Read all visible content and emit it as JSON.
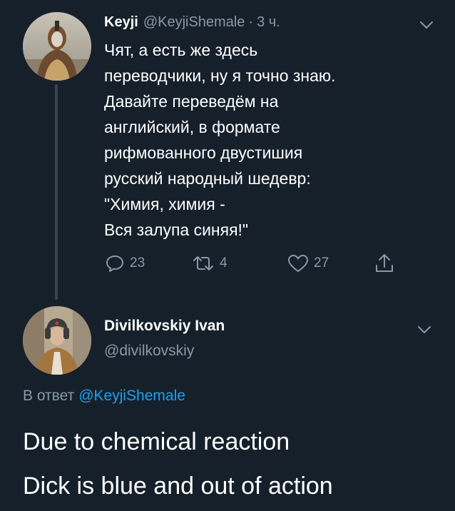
{
  "tweets": [
    {
      "author_name": "Keyji",
      "handle": "@KeyjiShemale",
      "separator": "·",
      "time": "3 ч.",
      "text_lines": [
        "Чят, а есть же здесь",
        "переводчики, ну я точно знаю.",
        "Давайте переведём на",
        "английский, в формате",
        "рифмованного двустишия",
        "русский народный шедевр:",
        "\"Химия, химия -",
        "Вся залупа синяя!\""
      ],
      "counts": {
        "replies": "23",
        "retweets": "4",
        "likes": "27"
      },
      "avatar_icon": "avatar-hooded-figure"
    },
    {
      "author_name": "Divilkovskiy Ivan",
      "handle": "@divilkovskiy",
      "reply_prefix": "В ответ",
      "reply_mention": "@KeyjiShemale",
      "text_lines": [
        "Due to chemical reaction",
        "Dick is blue and out of action"
      ],
      "avatar_icon": "avatar-man-in-ushanka"
    }
  ],
  "icons": {
    "reply": "reply-icon",
    "retweet": "retweet-icon",
    "like": "heart-icon",
    "share": "share-icon",
    "menu": "chevron-down-icon"
  },
  "colors": {
    "background": "#15202b",
    "text": "#ffffff",
    "secondary": "#8899a6",
    "link": "#1da1f2",
    "thread_line": "#38444d"
  }
}
